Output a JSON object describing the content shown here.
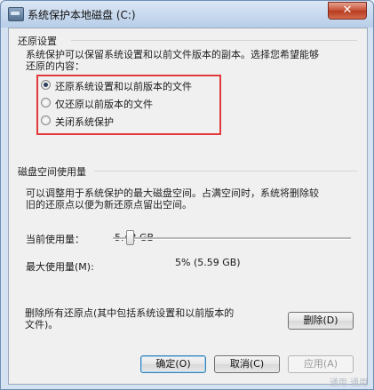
{
  "window": {
    "title": "系统保护本地磁盘 (C:)",
    "app_icon": "drive-icon",
    "close_label": "✕"
  },
  "restore_settings": {
    "group_title": "还原设置",
    "description_line1": "系统保护可以保留系统设置和以前文件版本的副本。选择您希望能够",
    "description_line2": "还原的内容：",
    "options": [
      {
        "label": "还原系统设置和以前版本的文件",
        "selected": true
      },
      {
        "label": "仅还原以前版本的文件",
        "selected": false
      },
      {
        "label": "关闭系统保护",
        "selected": false
      }
    ]
  },
  "disk_usage": {
    "group_title": "磁盘空间使用量",
    "description_line1": "可以调整用于系统保护的最大磁盘空间。占满空间时，系统将删除较",
    "description_line2": "旧的还原点以便为新还原点留出空间。",
    "current_label": "当前使用量：",
    "current_value": "5.43 GB",
    "max_label": "最大使用量(M):",
    "slider_fraction": 0.05,
    "max_value_text": "5% (5.59 GB)"
  },
  "delete_section": {
    "description_line1": "删除所有还原点(其中包括系统设置和以前版本的",
    "description_line2": "文件)。",
    "delete_label": "删除(D)"
  },
  "footer": {
    "ok_label": "确定(O)",
    "cancel_label": "取消(C)",
    "apply_label": "应用(A)",
    "watermark": "通用 通用"
  },
  "colors": {
    "highlight_box": "#e2393a",
    "close_button": "#c54d32"
  }
}
